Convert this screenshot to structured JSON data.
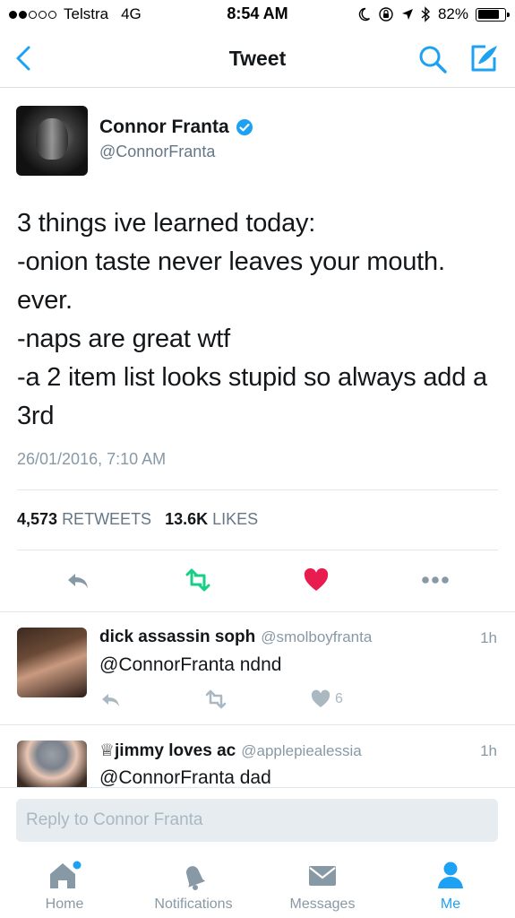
{
  "status_bar": {
    "carrier": "Telstra",
    "network": "4G",
    "time": "8:54 AM",
    "battery": "82%",
    "battery_level": 0.82
  },
  "nav": {
    "title": "Tweet",
    "back_icon": "chevron-left-icon",
    "search_icon": "search-icon",
    "compose_icon": "compose-icon"
  },
  "tweet": {
    "author_name": "Connor Franta",
    "author_handle": "@ConnorFranta",
    "verified": true,
    "text": "3 things ive learned today:\n-onion taste never leaves your mouth. ever.\n-naps are great wtf\n-a 2 item list looks stupid so always add a 3rd",
    "timestamp": "26/01/2016, 7:10 AM",
    "retweets_count": "4,573",
    "retweets_label": "RETWEETS",
    "likes_count": "13.6K",
    "likes_label": "LIKES"
  },
  "replies": [
    {
      "name": "dick assassin soph",
      "handle": "@smolboyfranta",
      "time": "1h",
      "text": "@ConnorFranta ndnd",
      "like_count": "6"
    },
    {
      "name": "♕jimmy loves ac",
      "handle": "@applepiealessia",
      "time": "1h",
      "text": "@ConnorFranta dad"
    }
  ],
  "reply_box": {
    "placeholder": "Reply to Connor Franta"
  },
  "tabs": [
    {
      "label": "Home",
      "icon": "home-icon"
    },
    {
      "label": "Notifications",
      "icon": "bell-icon"
    },
    {
      "label": "Messages",
      "icon": "envelope-icon"
    },
    {
      "label": "Me",
      "icon": "person-icon",
      "active": true
    }
  ],
  "colors": {
    "accent": "#1da1f2",
    "retweet": "#19cf86",
    "like": "#e81c4f",
    "secondary_text": "#657786"
  }
}
